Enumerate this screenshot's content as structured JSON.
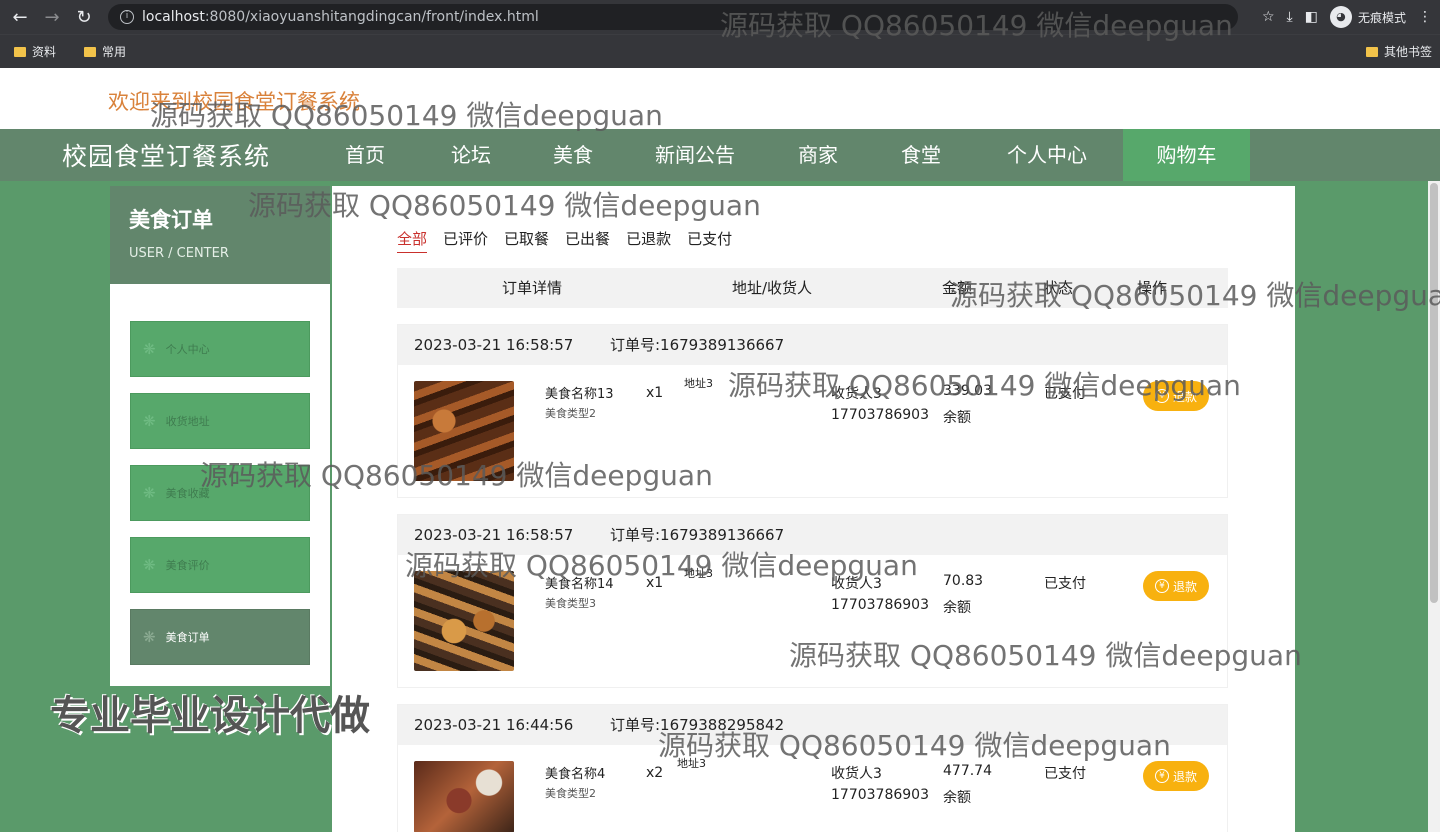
{
  "browser": {
    "url_host": "localhost",
    "url_rest": ":8080/xiaoyuanshitangdingcan/front/index.html",
    "incognito_label": "无痕模式",
    "bookmarks": [
      "资料",
      "常用"
    ],
    "other_bookmarks": "其他书签"
  },
  "header": {
    "welcome": "欢迎来到校园食堂订餐系统",
    "site_title": "校园食堂订餐系统",
    "nav": [
      "首页",
      "论坛",
      "美食",
      "新闻公告",
      "商家",
      "食堂",
      "个人中心",
      "购物车"
    ]
  },
  "sidebar": {
    "title": "美食订单",
    "subtitle": "USER / CENTER",
    "items": [
      "个人中心",
      "收货地址",
      "美食收藏",
      "美食评价",
      "美食订单"
    ]
  },
  "tabs": [
    "全部",
    "已评价",
    "已取餐",
    "已出餐",
    "已退款",
    "已支付"
  ],
  "table_headers": [
    "订单详情",
    "地址/收货人",
    "金额",
    "状态",
    "操作"
  ],
  "orders": [
    {
      "date": "2023-03-21 16:58:57",
      "order_no": "订单号:1679389136667",
      "product_name": "美食名称13",
      "product_type": "美食类型2",
      "qty": "x1",
      "address": "地址3",
      "receiver": "收货人3",
      "phone": "17703786903",
      "amount": "339.03",
      "payment": "余额",
      "status": "已支付",
      "action": "退款"
    },
    {
      "date": "2023-03-21 16:58:57",
      "order_no": "订单号:1679389136667",
      "product_name": "美食名称14",
      "product_type": "美食类型3",
      "qty": "x1",
      "address": "地址3",
      "receiver": "收货人3",
      "phone": "17703786903",
      "amount": "70.83",
      "payment": "余额",
      "status": "已支付",
      "action": "退款"
    },
    {
      "date": "2023-03-21 16:44:56",
      "order_no": "订单号:1679388295842",
      "product_name": "美食名称4",
      "product_type": "美食类型2",
      "qty": "x2",
      "address": "地址3",
      "receiver": "收货人3",
      "phone": "17703786903",
      "amount": "477.74",
      "payment": "余额",
      "status": "已支付",
      "action": "退款"
    }
  ],
  "watermark": "源码获取 QQ86050149 微信deepguan",
  "promo": "专业毕业设计代做",
  "colors": {
    "nav_bg": "#62866c",
    "active_green": "#57a86b",
    "welcome_orange": "#d9823b",
    "refund_yellow": "#f8b10f",
    "tab_active_red": "#c9302c"
  }
}
